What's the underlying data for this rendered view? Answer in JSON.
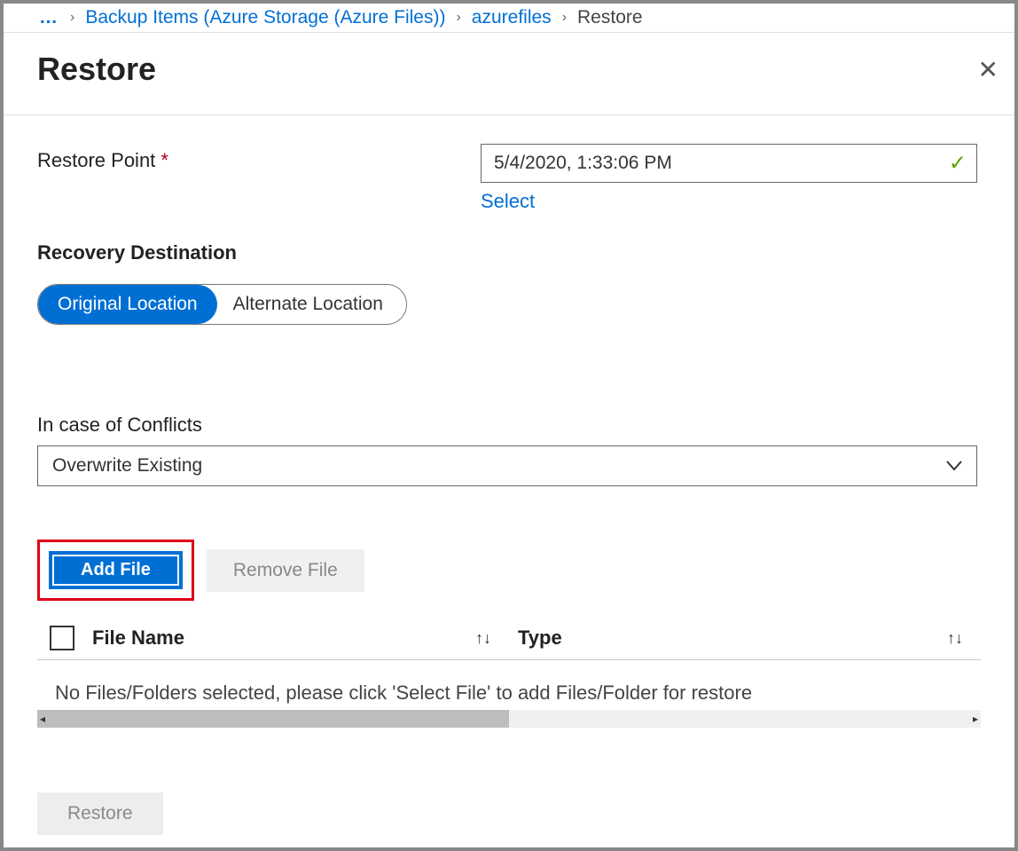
{
  "breadcrumb": {
    "ellipsis": "…",
    "items": [
      {
        "label": "Backup Items (Azure Storage (Azure Files))",
        "link": true
      },
      {
        "label": "azurefiles",
        "link": true
      },
      {
        "label": "Restore",
        "link": false
      }
    ]
  },
  "page": {
    "title": "Restore"
  },
  "restore_point": {
    "label": "Restore Point",
    "value": "5/4/2020, 1:33:06 PM",
    "select_link": "Select"
  },
  "recovery": {
    "title": "Recovery Destination",
    "options": [
      "Original Location",
      "Alternate Location"
    ],
    "selected": "Original Location"
  },
  "conflicts": {
    "label": "In case of Conflicts",
    "selected": "Overwrite Existing"
  },
  "file_actions": {
    "add": "Add File",
    "remove": "Remove File"
  },
  "table": {
    "columns": [
      "File Name",
      "Type"
    ],
    "empty_message": "No Files/Folders selected, please click 'Select File' to add Files/Folder for restore"
  },
  "footer": {
    "restore": "Restore"
  }
}
